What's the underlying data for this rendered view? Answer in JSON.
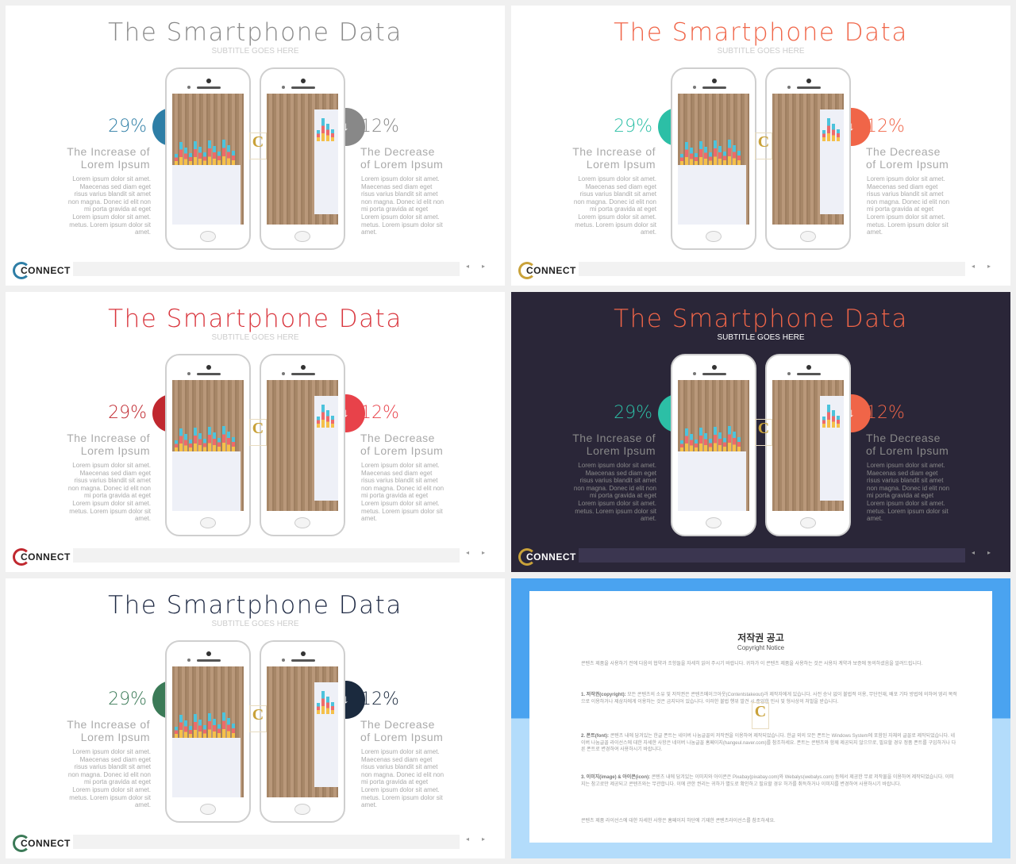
{
  "common": {
    "title": "The Smartphone Data",
    "subtitle": "SUBTITLE GOES HERE",
    "increase_pct": "29%",
    "decrease_pct": "12%",
    "increase_heading": "The Increase of Lorem Ipsum",
    "decrease_heading": "The Decrease of Lorem Ipsum",
    "body": "Lorem ipsum dolor sit amet. Maecenas sed diam eget risus varius blandit sit amet non magna. Donec id elit non mi porta gravida at eget Lorem ipsum dolor sit amet. metus. Lorem ipsum dolor sit amet.",
    "logo": "CONNECT",
    "watermark": "C",
    "up_icon": "arrow-up-icon",
    "down_icon": "arrow-down-icon"
  },
  "slides": [
    {
      "bg": "#ffffff",
      "title_color": "#8a8a8a",
      "sub_color": "#cccccc",
      "up_color": "#2e7ea6",
      "down_color": "#888888",
      "bar_color": "#f2f2f2",
      "ring": "#2e7ea6",
      "logo_color": "#222222"
    },
    {
      "bg": "#ffffff",
      "title_color": "#f06548",
      "sub_color": "#cccccc",
      "up_color": "#2cbfa6",
      "down_color": "#f06548",
      "bar_color": "#f2f2f2",
      "ring": "#c9a23a",
      "logo_color": "#222222"
    },
    {
      "bg": "#ffffff",
      "title_color": "#d9363e",
      "sub_color": "#cccccc",
      "up_color": "#c0282f",
      "down_color": "#e8424a",
      "bar_color": "#f2f2f2",
      "ring": "#c0282f",
      "logo_color": "#222222"
    },
    {
      "bg": "#2a2638",
      "title_color": "#f06548",
      "sub_color": "#ffffff",
      "up_color": "#2cbfa6",
      "down_color": "#f06548",
      "bar_color": "#3b3650",
      "ring": "#c9a23a",
      "logo_color": "#ffffff"
    },
    {
      "bg": "#ffffff",
      "title_color": "#1f2a44",
      "sub_color": "#cccccc",
      "up_color": "#3b7a57",
      "down_color": "#1b2a3e",
      "bar_color": "#f2f2f2",
      "ring": "#3b7a57",
      "logo_color": "#222222"
    }
  ],
  "copyright": {
    "title": "저작권 공고",
    "subtitle": "Copyright Notice",
    "intro": "콘텐츠 제품을 사용하기 전에 다음의 협약과 조항들을 자세히 읽어 주시기 바랍니다. 귀하가 이 콘텐츠 제품을 사용하는 것은 사용자 계약과 보증에 동의하셨음을 알려드립니다.",
    "items": [
      {
        "label": "1. 저작권(copyright):",
        "text": " 모든 콘텐츠의 소유 및 저작권은 콘텐츠메이크아웃(Contentstakeout)과 제작자에게 있습니다. 사전 승낙 없이 불법적 이용, 무단전재, 배포 기타 방법에 의하여 영리 목적으로 이용하거나 제삼자에게 이용하는 것은 금지되어 있습니다. 이러한 불법 행위 발견 시 준엄한 민사 및 형사상의 처벌을 받습니다."
      },
      {
        "label": "2. 폰트(font):",
        "text": " 콘텐츠 내에 담겨있는 한글 폰트는 네이버 나눔글꼴의 저작권을 이용하여 제작되었습니다. 한글 외의 모든 폰트는 Windows System에 포함된 자체의 글꼴로 제작되었습니다. 네이버 나눔글꼴 라이선스에 대한 자세한 사항은 네이버 나눔글꼴 홈페이지(hangeul.naver.com)를 참조하세요. 폰트는 콘텐츠와 함께 제공되지 않으므로, 필요할 경우 정품 폰트를 구입하거나 다른 폰트로 변경하여 사용하시기 바랍니다."
      },
      {
        "label": "3. 이미지(image) & 아이콘(icon):",
        "text": " 콘텐츠 내에 담겨있는 이미지와 아이콘은 Pixabay(pixabay.com)와 Webalys(webalys.com) 등에서 제공한 무료 저작물을 이용하여 제작되었습니다. 이미지는 참고로만 제공되고 콘텐츠와는 무관합니다. 이에 관한 권리는 귀하가 별도로 확인하고 필요할 경우 허가를 취득하거나 이미지를 변경하여 사용하시기 바랍니다."
      }
    ],
    "outro": "콘텐츠 제품 라이선스에 대한 자세한 사항은 홈페이지 하단에 기재한 콘텐츠라이선스를 참조하세요.",
    "watermark": "C"
  },
  "nav": {
    "prev": "◂",
    "next": "▸"
  }
}
